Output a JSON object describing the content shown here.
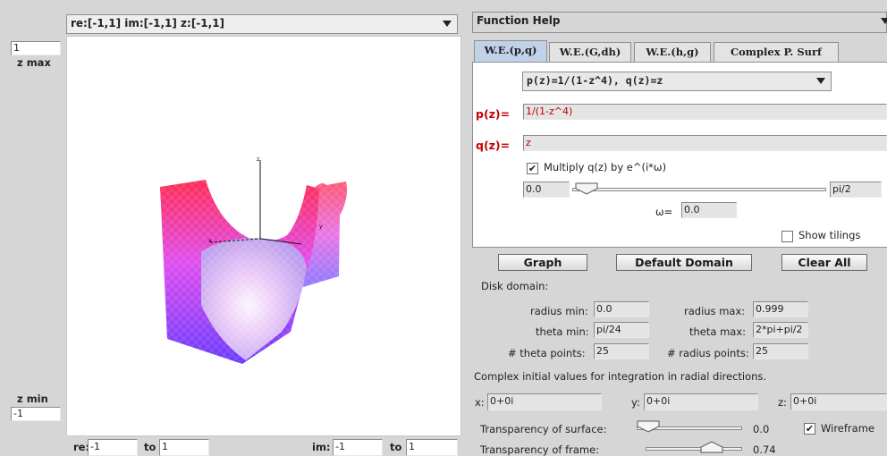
{
  "left": {
    "domain_combo": "re:[-1,1] im:[-1,1] z:[-1,1]",
    "zmax_value": "1",
    "zmax_label": "z max",
    "zmin_label": "z min",
    "zmin_value": "-1",
    "re_label": "re:",
    "re_from": "-1",
    "to_label": "to",
    "re_to": "1",
    "im_label": "im:",
    "im_from": "-1",
    "im_to": "1",
    "axis_labels": {
      "z": "z",
      "x": "x",
      "y": "y"
    }
  },
  "right": {
    "function_combo": "Function Help",
    "tabs": [
      {
        "label": "W.E.(p,q)",
        "active": true
      },
      {
        "label": "W.E.(G,dh)",
        "active": false
      },
      {
        "label": "W.E.(h,g)",
        "active": false
      },
      {
        "label": "Complex P. Surf",
        "active": false
      }
    ],
    "preset_combo": "p(z)=1/(1-z^4), q(z)=z",
    "p_label": "p(z)=",
    "p_value": "1/(1-z^4)",
    "q_label": "q(z)=",
    "q_value": "z",
    "multiply_label": "Multiply q(z) by e^(i*ω)",
    "multiply_checked": true,
    "omega_min": "0.0",
    "omega_max": "pi/2",
    "omega_label": "ω=",
    "omega_value": "0.0",
    "omega_fraction": 0.0,
    "show_tilings_label": "Show tilings",
    "show_tilings_checked": false,
    "buttons": {
      "graph": "Graph",
      "default_domain": "Default Domain",
      "clear_all": "Clear All"
    },
    "disk_domain_label": "Disk domain:",
    "radius_min_label": "radius min:",
    "radius_min": "0.0",
    "radius_max_label": "radius max:",
    "radius_max": "0.999",
    "theta_min_label": "theta min:",
    "theta_min": "pi/24",
    "theta_max_label": "theta max:",
    "theta_max": "2*pi+pi/2",
    "theta_points_label": "# theta points:",
    "theta_points": "25",
    "radius_points_label": "# radius points:",
    "radius_points": "25",
    "complex_init_label": "Complex initial values for integration in radial directions.",
    "x_label": "x:",
    "x_value": "0+0i",
    "y_label": "y:",
    "y_value": "0+0i",
    "z_label": "z:",
    "z_value": "0+0i",
    "transp_surface_label": "Transparency of surface:",
    "transp_surface_value": "0.0",
    "transp_surface_fraction": 0.0,
    "wireframe_label": "Wireframe",
    "wireframe_checked": true,
    "transp_frame_label": "Transparency of frame:",
    "transp_frame_value": "0.74",
    "transp_frame_fraction": 0.74
  },
  "colors": {
    "accent_tab": "#bfd2ea",
    "red_label": "#c20000"
  }
}
